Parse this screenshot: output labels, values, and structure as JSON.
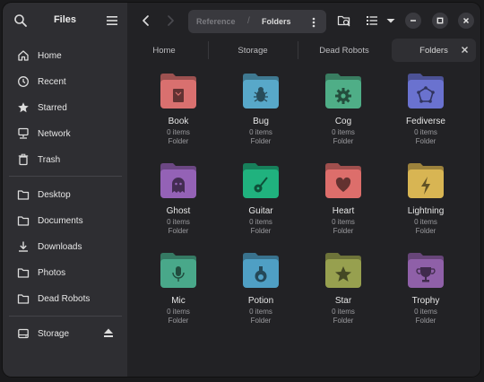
{
  "sidebar": {
    "title": "Files",
    "items": [
      {
        "label": "Home",
        "icon": "home-icon"
      },
      {
        "label": "Recent",
        "icon": "clock-icon"
      },
      {
        "label": "Starred",
        "icon": "star-icon"
      },
      {
        "label": "Network",
        "icon": "network-icon"
      },
      {
        "label": "Trash",
        "icon": "trash-icon"
      },
      {
        "label": "Desktop",
        "icon": "folder-icon"
      },
      {
        "label": "Documents",
        "icon": "folder-icon"
      },
      {
        "label": "Downloads",
        "icon": "download-icon"
      },
      {
        "label": "Photos",
        "icon": "folder-icon"
      },
      {
        "label": "Dead Robots",
        "icon": "folder-icon"
      },
      {
        "label": "Storage",
        "icon": "drive-icon"
      }
    ]
  },
  "path": {
    "segments": [
      "Reference",
      "Folders"
    ],
    "separator": "/"
  },
  "tabs": [
    {
      "label": "Home"
    },
    {
      "label": "Storage"
    },
    {
      "label": "Dead Robots"
    },
    {
      "label": "Folders"
    }
  ],
  "folders": [
    {
      "name": "Book",
      "count": "0 items",
      "type": "Folder",
      "color": "#d9706f",
      "emblem": "book"
    },
    {
      "name": "Bug",
      "count": "0 items",
      "type": "Folder",
      "color": "#58a8c9",
      "emblem": "bug"
    },
    {
      "name": "Cog",
      "count": "0 items",
      "type": "Folder",
      "color": "#4fae87",
      "emblem": "cog"
    },
    {
      "name": "Fediverse",
      "count": "0 items",
      "type": "Folder",
      "color": "#6a72cf",
      "emblem": "fediverse"
    },
    {
      "name": "Ghost",
      "count": "0 items",
      "type": "Folder",
      "color": "#9462b6",
      "emblem": "ghost"
    },
    {
      "name": "Guitar",
      "count": "0 items",
      "type": "Folder",
      "color": "#20b27e",
      "emblem": "guitar"
    },
    {
      "name": "Heart",
      "count": "0 items",
      "type": "Folder",
      "color": "#dd6e6b",
      "emblem": "heart"
    },
    {
      "name": "Lightning",
      "count": "0 items",
      "type": "Folder",
      "color": "#d8b553",
      "emblem": "lightning"
    },
    {
      "name": "Mic",
      "count": "0 items",
      "type": "Folder",
      "color": "#49a88a",
      "emblem": "mic"
    },
    {
      "name": "Potion",
      "count": "0 items",
      "type": "Folder",
      "color": "#4f9fc4",
      "emblem": "potion"
    },
    {
      "name": "Star",
      "count": "0 items",
      "type": "Folder",
      "color": "#97a04f",
      "emblem": "star"
    },
    {
      "name": "Trophy",
      "count": "0 items",
      "type": "Folder",
      "color": "#8f60a8",
      "emblem": "trophy"
    }
  ],
  "colors": {
    "sidebar_bg": "#2e2e32",
    "main_bg": "#222225",
    "text": "#e6e6e6",
    "muted": "#9a9a9e"
  }
}
